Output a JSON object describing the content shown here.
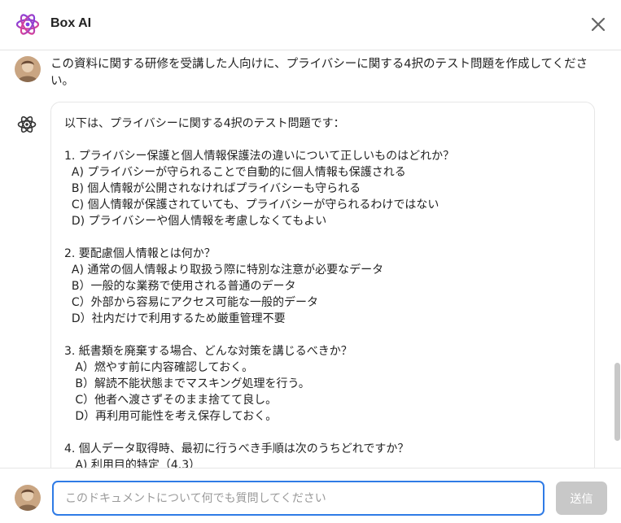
{
  "header": {
    "title": "Box AI",
    "logo_icon": "box-ai-atom-icon",
    "close_icon": "close-icon"
  },
  "conversation": {
    "user_message": "この資料に関する研修を受講した人向けに、プライバシーに関する4択のテスト問題を作成してください。",
    "ai_response": "以下は、プライバシーに関する4択のテスト問題です：\n\n1. プライバシー保護と個人情報保護法の違いについて正しいものはどれか？\n  A) プライバシーが守られることで自動的に個人情報も保護される\n  B) 個人情報が公開されなければプライバシーも守られる\n  C) 個人情報が保護されていても、プライバシーが守られるわけではない\n  D) プライバシーや個人情報を考慮しなくてもよい\n\n2. 要配慮個人情報とは何か？\n  A) 通常の個人情報より取扱う際に特別な注意が必要なデータ\n  B）一般的な業務で使用される普通のデータ\n  C）外部から容易にアクセス可能な一般的データ\n  D）社内だけで利用するため厳重管理不要\n\n3. 紙書類を廃棄する場合、どんな対策を講じるべきか？\n   A）燃やす前に内容確認しておく。\n   B）解読不能状態までマスキング処理を行う。\n   C）他者へ渡さずそのまま捨てて良し。\n   D）再利用可能性を考え保存しておく。\n\n4. 個人データ取得時、最初に行うべき手順は次のうちどれですか？\n   A) 利用目的特定（4.3）"
  },
  "composer": {
    "placeholder": "このドキュメントについて何でも質問してください",
    "send_label": "送信"
  },
  "colors": {
    "accent": "#2f7be6",
    "send_disabled": "#c8c8c8",
    "logo_purple": "#7b3fe4",
    "logo_pink": "#e8418a"
  }
}
